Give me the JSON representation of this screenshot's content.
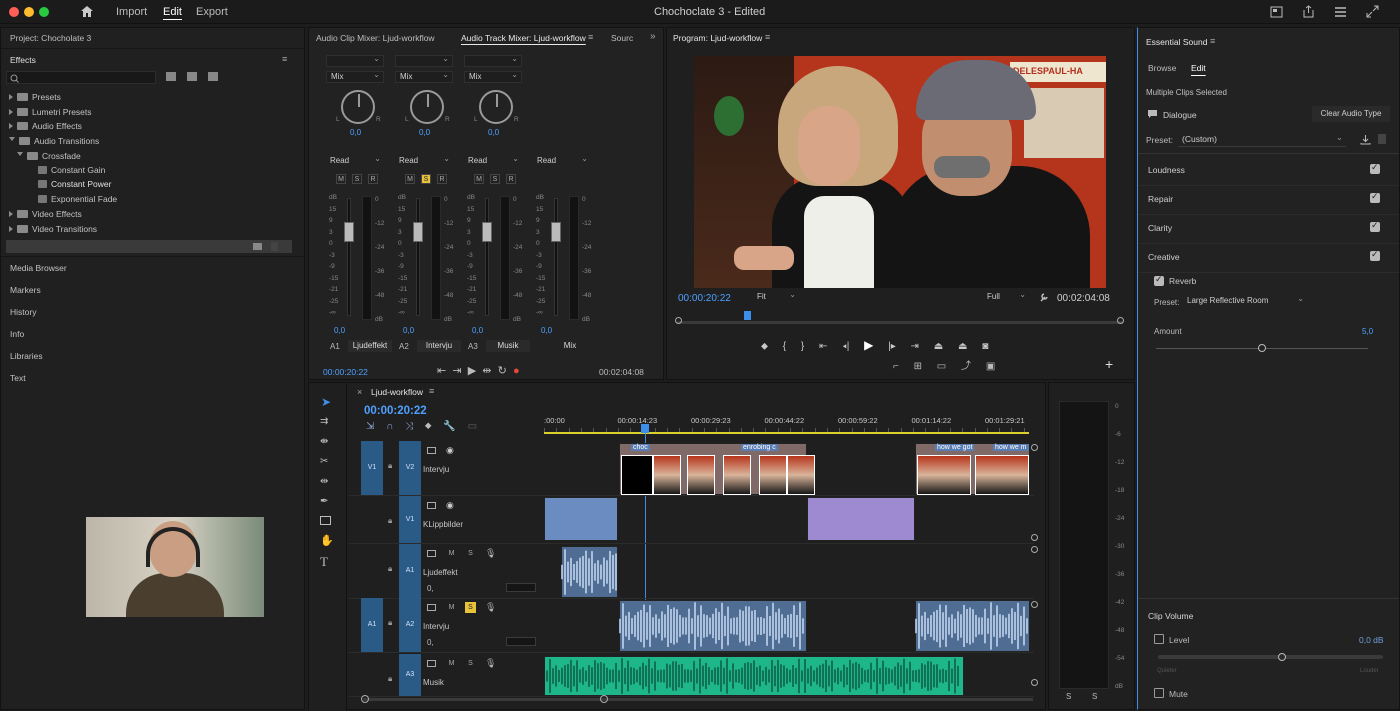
{
  "window": {
    "title": "Chochoclate 3 - Edited",
    "tabs": [
      {
        "label": "Import"
      },
      {
        "label": "Edit"
      },
      {
        "label": "Export"
      }
    ]
  },
  "project": {
    "title": "Project: Chocholate 3"
  },
  "effects": {
    "title": "Effects",
    "tree": [
      {
        "label": "Presets"
      },
      {
        "label": "Lumetri Presets"
      },
      {
        "label": "Audio Effects"
      },
      {
        "label": "Audio Transitions"
      },
      {
        "label": "Crossfade"
      },
      {
        "label": "Constant Gain"
      },
      {
        "label": "Constant Power"
      },
      {
        "label": "Exponential Fade"
      },
      {
        "label": "Video Effects"
      },
      {
        "label": "Video Transitions"
      }
    ]
  },
  "left_panels": [
    {
      "label": "Media Browser"
    },
    {
      "label": "Markers"
    },
    {
      "label": "History"
    },
    {
      "label": "Info"
    },
    {
      "label": "Libraries"
    },
    {
      "label": "Text"
    }
  ],
  "mixer": {
    "tabs": [
      {
        "label": "Audio Clip Mixer: Ljud-workflow"
      },
      {
        "label": "Audio Track Mixer: Ljud-workflow"
      },
      {
        "label": "Sourc"
      }
    ],
    "channels": [
      {
        "mode": "Mix",
        "read": "Read",
        "pan": "0,0",
        "vol": "0,0",
        "id": "A1",
        "name": "Ljudeffekt",
        "m": "M",
        "s": "S",
        "r": "R",
        "l": "L",
        "rr": "R"
      },
      {
        "mode": "Mix",
        "read": "Read",
        "pan": "0,0",
        "vol": "0,0",
        "id": "A2",
        "name": "Intervju",
        "m": "M",
        "s": "S",
        "r": "R",
        "l": "L",
        "rr": "R"
      },
      {
        "mode": "Mix",
        "read": "Read",
        "pan": "0,0",
        "vol": "0,0",
        "id": "A3",
        "name": "Musik",
        "m": "M",
        "s": "S",
        "r": "R",
        "l": "L",
        "rr": "R"
      },
      {
        "mode": "",
        "read": "Read",
        "pan": "",
        "vol": "0,0",
        "id": "",
        "name": "Mix",
        "m": "",
        "s": "",
        "r": "",
        "l": "",
        "rr": ""
      }
    ],
    "scale_left": [
      "dB",
      "15",
      "9",
      "3",
      "0",
      "-3",
      "-9",
      "-15",
      "-21",
      "-25",
      "-∞"
    ],
    "scale_right": [
      "0",
      "-12",
      "-24",
      "-36",
      "-48",
      "dB"
    ],
    "timecode_in": "00:00:20:22",
    "timecode_out": "00:02:04:08"
  },
  "program": {
    "title": "Program: Ljud-workflow",
    "timecode": "00:00:20:22",
    "fit": "Fit",
    "quality": "Full",
    "duration": "00:02:04:08",
    "sign_text": "DELESPAUL-HA"
  },
  "timeline": {
    "title": "Ljud-workflow",
    "timecode": "00:00:20:22",
    "ruler": [
      ":00:00",
      "00:00:14:23",
      "00:00:29:23",
      "00:00:44:22",
      "00:00:59:22",
      "00:01:14:22",
      "00:01:29:21"
    ],
    "tracks": [
      {
        "id": "V2",
        "src": "V1",
        "name": "Intervju"
      },
      {
        "id": "V1",
        "src": "V1",
        "name": "KLippbilder"
      },
      {
        "id": "A1",
        "src": "A1",
        "name": "Ljudeffekt"
      },
      {
        "id": "A2",
        "src": "A1",
        "name": "Intervju"
      },
      {
        "id": "A3",
        "src": "",
        "name": "Musik"
      }
    ],
    "track_buttons": {
      "m": "M",
      "s": "S",
      "vol": "0,"
    },
    "clip_labels": [
      "choc",
      "enrobing c",
      "how we got",
      "how we m"
    ],
    "audio_meter_scale": [
      "0",
      "-6",
      "-12",
      "-18",
      "-24",
      "-30",
      "-36",
      "-42",
      "-48",
      "-54",
      "dB"
    ],
    "meter_solo": [
      "S",
      "S"
    ]
  },
  "essential_sound": {
    "title": "Essential Sound",
    "tabs": [
      {
        "label": "Browse"
      },
      {
        "label": "Edit"
      }
    ],
    "status": "Multiple Clips Selected",
    "type": "Dialogue",
    "clear_button": "Clear Audio Type",
    "preset_label": "Preset:",
    "preset_value": "(Custom)",
    "sections": [
      {
        "label": "Loudness"
      },
      {
        "label": "Repair"
      },
      {
        "label": "Clarity"
      },
      {
        "label": "Creative"
      }
    ],
    "reverb_label": "Reverb",
    "reverb_preset_label": "Preset:",
    "reverb_preset_value": "Large Reflective Room",
    "amount_label": "Amount",
    "amount_value": "5,0",
    "amount": 0.5,
    "clip_volume_title": "Clip Volume",
    "level_label": "Level",
    "level_value": "0,0 dB",
    "level": 0.55,
    "quieter": "Quieter",
    "louder": "Louder",
    "mute_label": "Mute"
  },
  "colors": {
    "accent": "#2d8ceb",
    "timecode": "#4ea0ff",
    "solo": "#e8c23a",
    "music": "#1db78a"
  }
}
